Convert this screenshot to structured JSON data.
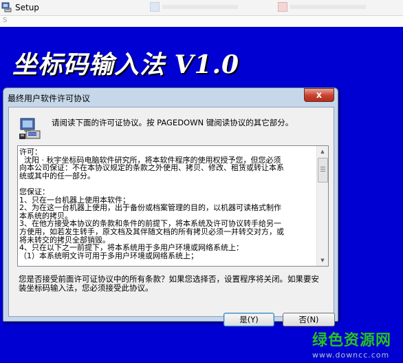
{
  "taskbar": {
    "app_title": "Setup",
    "sub_strip_char": "S"
  },
  "background": {
    "title": "坐标码输入法 V1.0"
  },
  "dialog": {
    "title": "最终用户软件许可协议",
    "intro": "请阅读下面的许可证协议。按 PAGEDOWN 键阅读协议的其它部分。",
    "license_lines": [
      "许可：",
      "  沈阳 · 秋宇坐标码电脑软件研究所，将本软件程序的使用权授予您，但您必须",
      "向本公司保证：不在本协议规定的条款之外使用、拷贝、修改、租赁或转让本系",
      "统或其中的任一部分。",
      "",
      "您保证：",
      "1、只在一台机器上使用本软件；",
      "2、为在这一台机器上使用，出于备份或档案管理的目的，以机器可读格式制作",
      "本系统的拷贝。",
      "3、在他方接受本协议的条款和条件的前提下，将本系统及许可协议转手给另一",
      "方使用，如若发生转手，原文档及其伴随文档的所有拷贝必须一并转交对方，或",
      "将未转交的拷贝全部销毁。",
      "4、只在以下之一前提下，将本系统用于多用户环境或网络系统上：",
      "（1）本系统明文许可用于多用户环境或网络系统上；"
    ],
    "question": "您是否接受前面许可证协议中的所有条款？如果您选择否，设置程序将关闭。如果要安装坐标码输入法，您必须接受此协议。",
    "yes_label": "是(Y)",
    "no_label": "否(N)",
    "close_label": "x"
  },
  "watermark": {
    "main": "绿色资源网",
    "url": "www.downcc.com"
  }
}
